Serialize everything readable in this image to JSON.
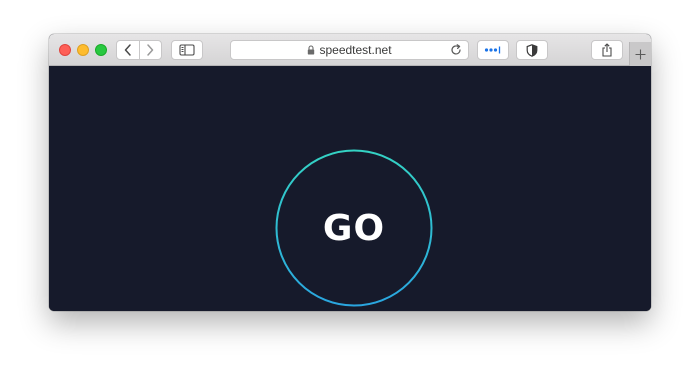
{
  "browser": {
    "url": "speedtest.net",
    "toolbar": {
      "back_icon": "chevron-left-icon",
      "forward_icon": "chevron-right-icon",
      "sidebar_icon": "sidebar-icon",
      "lock_icon": "lock-icon",
      "reload_icon": "reload-icon",
      "password_icon": "password-dots-icon",
      "shield_icon": "shield-icon",
      "share_icon": "share-icon",
      "newtab_icon": "plus-icon"
    }
  },
  "page": {
    "go_label": "GO",
    "background_color": "#161a2b",
    "ring_color_start": "#34d3c4",
    "ring_color_end": "#2aa6e0"
  }
}
